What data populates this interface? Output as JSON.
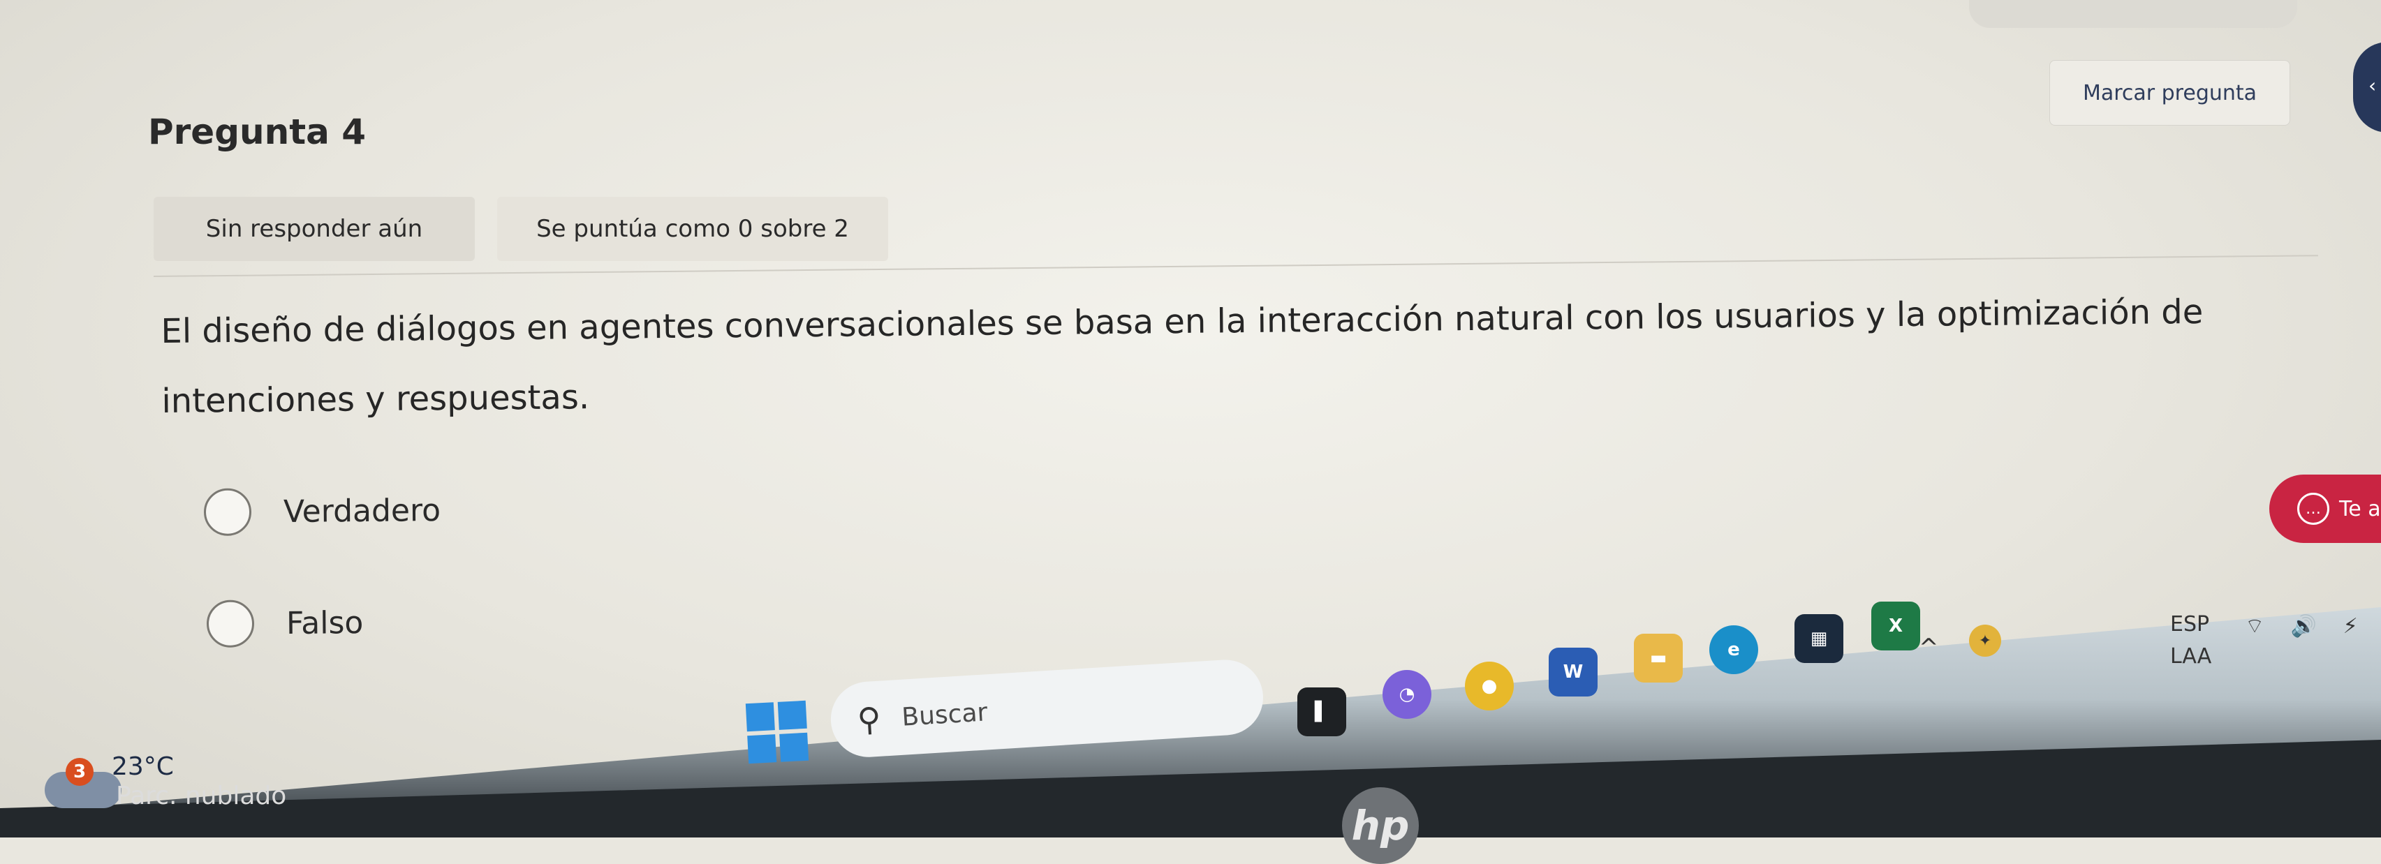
{
  "quiz": {
    "mark_button": "Marcar pregunta",
    "question_title": "Pregunta 4",
    "status_badge": "Sin responder aún",
    "score_badge": "Se puntúa como 0 sobre 2",
    "question_text": "El diseño de diálogos en agentes conversacionales se basa en la interacción natural con los usuarios y la optimización de intenciones y respuestas.",
    "options": [
      {
        "label": "Verdadero"
      },
      {
        "label": "Falso"
      }
    ],
    "chat_pill_text": "Te a"
  },
  "taskbar": {
    "weather": {
      "badge": "3",
      "temperature": "23°C",
      "condition": "Parc. nublado"
    },
    "search_placeholder": "Buscar",
    "apps": [
      {
        "name": "task-view",
        "glyph": "▌"
      },
      {
        "name": "copilot",
        "glyph": "◔"
      },
      {
        "name": "chrome",
        "glyph": "●"
      },
      {
        "name": "word",
        "glyph": "W"
      },
      {
        "name": "file-explorer",
        "glyph": "▬"
      },
      {
        "name": "edge",
        "glyph": "e"
      },
      {
        "name": "store",
        "glyph": "▦"
      },
      {
        "name": "excel",
        "glyph": "X"
      }
    ],
    "tray": {
      "lang_line1": "ESP",
      "lang_line2": "LAA",
      "icons": "⌔ 🔊 ⚡"
    }
  },
  "colors": {
    "accent_blue": "#27375a",
    "chat_red": "#c92442",
    "windows_blue": "#2e8fe0"
  }
}
